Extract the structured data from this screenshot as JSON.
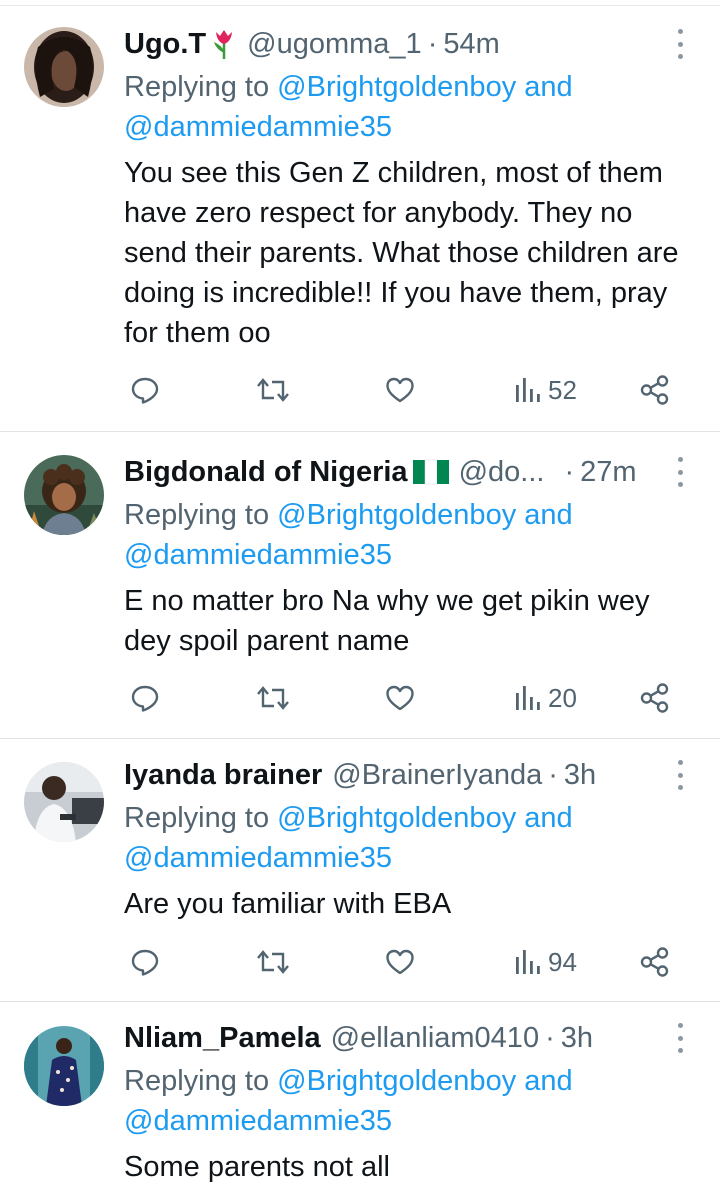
{
  "replying_prefix": "Replying to ",
  "replying_mention_1": "@Brightgoldenboy",
  "replying_and": " and",
  "replying_mention_2": "@dammiedammie35",
  "separator": "·",
  "tweets": [
    {
      "name": "Ugo.T",
      "name_emoji": "tulip-icon",
      "handle": "@ugomma_1",
      "time": "54m",
      "body": "You see this Gen Z children, most of them have zero respect for anybody. They no send their parents. What those children are doing is incredible!! If you have them, pray for them oo",
      "views": "52"
    },
    {
      "name": "Bigdonald of Nigeria",
      "name_emoji": "nigeria-flag-icon",
      "handle": "@do...",
      "time": "27m",
      "body": "E no matter bro Na why we get pikin wey dey spoil parent name",
      "views": "20"
    },
    {
      "name": "Iyanda brainer",
      "handle": "@BrainerIyanda",
      "time": "3h",
      "body": "Are you familiar with EBA",
      "views": "94"
    },
    {
      "name": "Nliam_Pamela",
      "handle": "@ellanliam0410",
      "time": "3h",
      "body": "Some parents not all"
    }
  ],
  "colors": {
    "text": "#0f1419",
    "secondary": "#536471",
    "link": "#1d9bf0",
    "divider": "#e1e4e7"
  }
}
